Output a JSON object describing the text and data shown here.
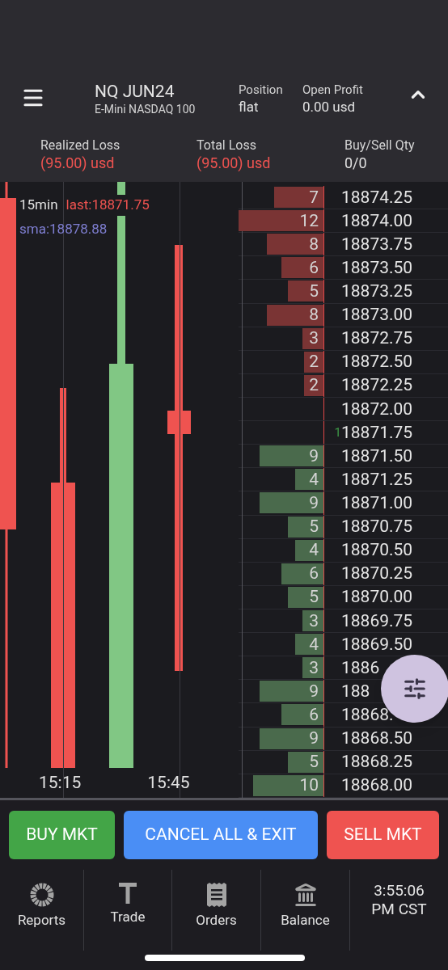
{
  "header": {
    "symbol": "NQ JUN24",
    "description": "E-Mini NASDAQ 100",
    "expanded": true,
    "stats": [
      {
        "label": "Position",
        "value": "flat"
      },
      {
        "label": "Open Profit",
        "value": "0.00 usd"
      }
    ]
  },
  "summary": [
    {
      "label": "Realized Loss",
      "value": "(95.00) usd",
      "negative": true
    },
    {
      "label": "Total Loss",
      "value": "(95.00) usd",
      "negative": true
    },
    {
      "label": "Buy/Sell Qty",
      "value": "0/0",
      "negative": false
    }
  ],
  "chart": {
    "interval": "15min",
    "last": "last:18871.75",
    "sma": "sma:18878.88",
    "time_labels": [
      "15:15",
      "15:45"
    ]
  },
  "ladder": [
    {
      "kind": "ask",
      "qty": "7",
      "price": "18874.25"
    },
    {
      "kind": "ask",
      "qty": "12",
      "price": "18874.00"
    },
    {
      "kind": "ask",
      "qty": "8",
      "price": "18873.75"
    },
    {
      "kind": "ask",
      "qty": "6",
      "price": "18873.50"
    },
    {
      "kind": "ask",
      "qty": "5",
      "price": "18873.25"
    },
    {
      "kind": "ask",
      "qty": "8",
      "price": "18873.00"
    },
    {
      "kind": "ask",
      "qty": "3",
      "price": "18872.75"
    },
    {
      "kind": "ask",
      "qty": "2",
      "price": "18872.50"
    },
    {
      "kind": "ask",
      "qty": "2",
      "price": "18872.25"
    },
    {
      "price": "18872.00"
    },
    {
      "trade": "1",
      "price": "18871.75"
    },
    {
      "kind": "bid",
      "qty": "9",
      "price": "18871.50"
    },
    {
      "kind": "bid",
      "qty": "4",
      "price": "18871.25"
    },
    {
      "kind": "bid",
      "qty": "9",
      "price": "18871.00"
    },
    {
      "kind": "bid",
      "qty": "5",
      "price": "18870.75"
    },
    {
      "kind": "bid",
      "qty": "4",
      "price": "18870.50"
    },
    {
      "kind": "bid",
      "qty": "6",
      "price": "18870.25"
    },
    {
      "kind": "bid",
      "qty": "5",
      "price": "18870.00"
    },
    {
      "kind": "bid",
      "qty": "3",
      "price": "18869.75"
    },
    {
      "kind": "bid",
      "qty": "4",
      "price": "18869.50"
    },
    {
      "kind": "bid",
      "qty": "3",
      "price": "1886"
    },
    {
      "kind": "bid",
      "qty": "9",
      "price": "188"
    },
    {
      "kind": "bid",
      "qty": "6",
      "price": "18868."
    },
    {
      "kind": "bid",
      "qty": "9",
      "price": "18868.50"
    },
    {
      "kind": "bid",
      "qty": "5",
      "price": "18868.25"
    },
    {
      "kind": "bid",
      "qty": "10",
      "price": "18868.00"
    }
  ],
  "actions": [
    {
      "label": "BUY MKT",
      "kind": "buy"
    },
    {
      "label": "CANCEL ALL & EXIT",
      "kind": "cancel"
    },
    {
      "label": "SELL MKT",
      "kind": "sell"
    }
  ],
  "nav": [
    {
      "label": "Reports",
      "kind": "reports"
    },
    {
      "label": "Trade",
      "kind": "trade"
    },
    {
      "label": "Orders",
      "kind": "orders"
    },
    {
      "label": "Balance",
      "kind": "balance"
    }
  ],
  "clock": [
    "3:55:06",
    "PM CST"
  ]
}
